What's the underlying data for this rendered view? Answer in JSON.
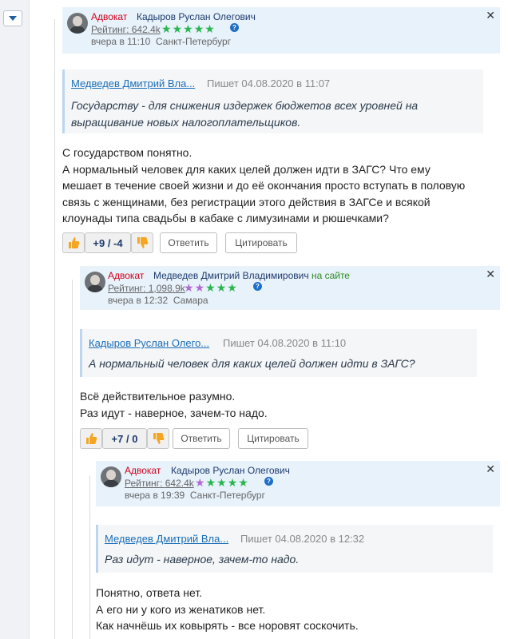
{
  "comments": [
    {
      "role": "Адвокат",
      "name": "Кадыров Руслан Олегович",
      "status": "",
      "rating_label": "Рейтинг",
      "rating_value": "642.4k",
      "stars": {
        "purple": 0,
        "green": 5
      },
      "date": "вчера в 11:10",
      "city": "Санкт-Петербург",
      "quote": {
        "author": "Медведев Дмитрий Вла...",
        "meta": "Пишет 04.08.2020 в 11:07",
        "lines": [
          "Государству - для снижения издержек бюджетов всех уровней на",
          "выращивание новых налогоплательщиков."
        ]
      },
      "body": [
        "С государством понятно.",
        "А нормальный человек для каких целей должен идти в ЗАГС? Что ему",
        "мешает в течение своей жизни и до её окончания просто вступать в половую",
        "связь с женщинами, без регистрации этого действия в ЗАГСе и всякой",
        "клоунады типа свадьбы в кабаке с лимузинами и рюшечками?"
      ],
      "score": "+9 / -4",
      "reply_label": "Ответить",
      "cite_label": "Цитировать"
    },
    {
      "role": "Адвокат",
      "name": "Медведев Дмитрий Владимирович",
      "status": "на сайте",
      "rating_label": "Рейтинг",
      "rating_value": "1,098.9k",
      "stars": {
        "purple": 2,
        "green": 3
      },
      "date": "вчера в 12:32",
      "city": "Самара",
      "quote": {
        "author": "Кадыров Руслан Олего...",
        "meta": "Пишет 04.08.2020 в 11:10",
        "lines": [
          "А нормальный человек для каких целей должен идти в ЗАГС?"
        ]
      },
      "body": [
        "Всё действительное разумно.",
        "Раз идут - наверное, зачем-то надо."
      ],
      "score": "+7 / 0",
      "reply_label": "Ответить",
      "cite_label": "Цитировать"
    },
    {
      "role": "Адвокат",
      "name": "Кадыров Руслан Олегович",
      "status": "",
      "rating_label": "Рейтинг",
      "rating_value": "642.4k",
      "stars": {
        "purple": 1,
        "green": 4
      },
      "date": "вчера в 19:39",
      "city": "Санкт-Петербург",
      "quote": {
        "author": "Медведев Дмитрий Вла...",
        "meta": "Пишет 04.08.2020 в 12:32",
        "lines": [
          "Раз идут - наверное, зачем-то надо."
        ]
      },
      "body": [
        "Понятно, ответа нет.",
        "А его ни у кого из женатиков нет.",
        "Как начнёшь их ковырять - все норовят соскочить."
      ]
    }
  ],
  "icons": {
    "collapse": "chevron-down-icon",
    "close": "close-icon",
    "help": "help-icon",
    "like": "thumbs-up-icon",
    "dislike": "thumbs-down-icon"
  },
  "glyphs": {
    "close": "✕",
    "help": "?",
    "star": "★"
  },
  "colors": {
    "role": "#d0021b",
    "online": "#2e8b21",
    "accent": "#1b6fb9",
    "thumb": "#f4a623",
    "header_bg": "#e8f2fb"
  }
}
